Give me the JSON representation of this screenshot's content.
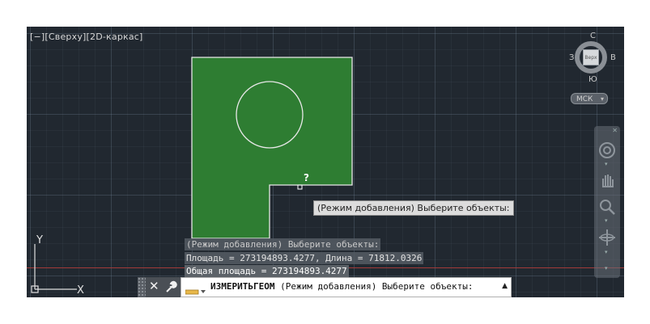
{
  "viewport": {
    "view_label": "[−][Сверху][2D-каркас]"
  },
  "cursor_hint": "?",
  "tooltip": "(Режим добавления) Выберите объекты:",
  "history": {
    "line1": "(Режим добавления) Выберите объекты:",
    "line2": "Площадь = 273194893.4277, Длина = 71812.0326",
    "line3": "Общая площадь = 273194893.4277"
  },
  "ucs": {
    "y_label": "Y",
    "x_label": "X"
  },
  "viewcube": {
    "north": "С",
    "south": "Ю",
    "west": "З",
    "east": "В",
    "face": "Верх"
  },
  "ucs_dropdown": {
    "label": "МСК"
  },
  "commandline": {
    "close_symbol": "✕",
    "command_name": "ИЗМЕРИТЬГЕОМ",
    "command_prompt": " (Режим добавления) Выберите объекты:"
  },
  "colors": {
    "viewport_bg": "#212830",
    "fill_green": "#2e7d32",
    "outline": "#e8e8e8",
    "red_axis": "#a23a3a"
  },
  "icons": {
    "cmd_customize": "wrench-icon",
    "cmd_prompt": "command-prompt-icon",
    "nav_steering": "steering-wheel-icon",
    "nav_pan": "pan-hand-icon",
    "nav_zoom": "zoom-icon",
    "nav_orbit": "orbit-icon"
  }
}
